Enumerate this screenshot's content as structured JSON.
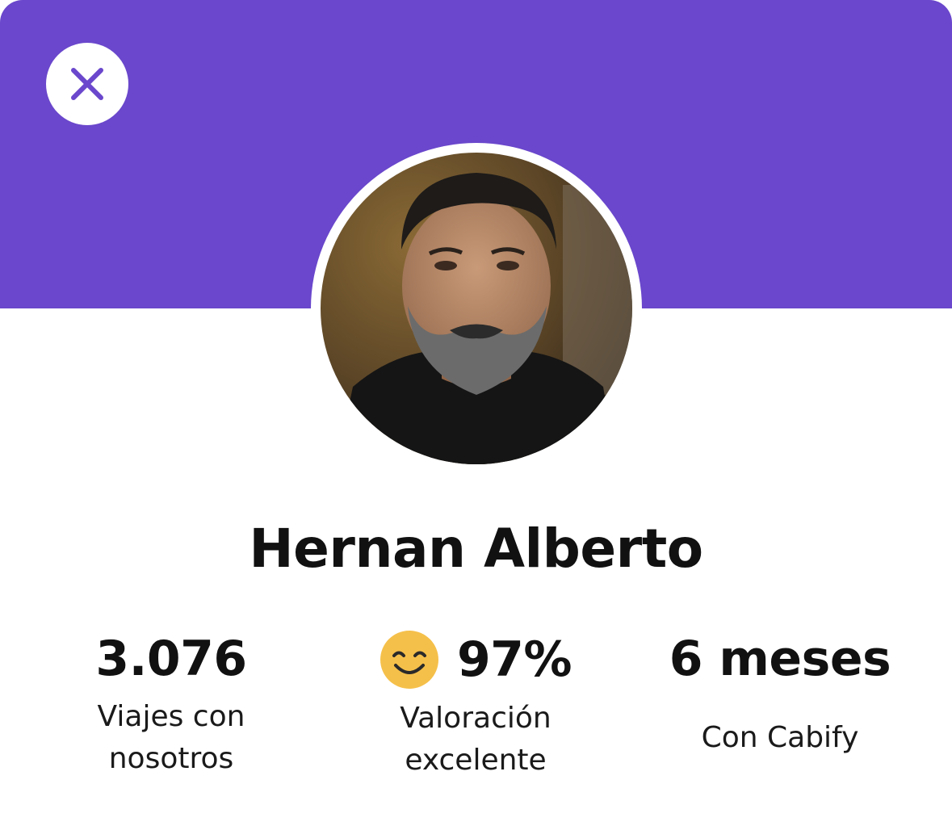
{
  "colors": {
    "brand_purple": "#6a47cc",
    "smile_yellow": "#f5c04a",
    "text": "#111111",
    "background": "#ffffff"
  },
  "header": {
    "close_icon": "close-icon"
  },
  "driver": {
    "name": "Hernan Alberto",
    "photo": "driver-avatar"
  },
  "stats": [
    {
      "value": "3.076",
      "label_line1": "Viajes con",
      "label_line2": "nosotros"
    },
    {
      "icon": "smile-emoji-icon",
      "value": "97%",
      "label_line1": "Valoración",
      "label_line2": "excelente"
    },
    {
      "value": "6 meses",
      "label_line1": "Con Cabify"
    }
  ]
}
